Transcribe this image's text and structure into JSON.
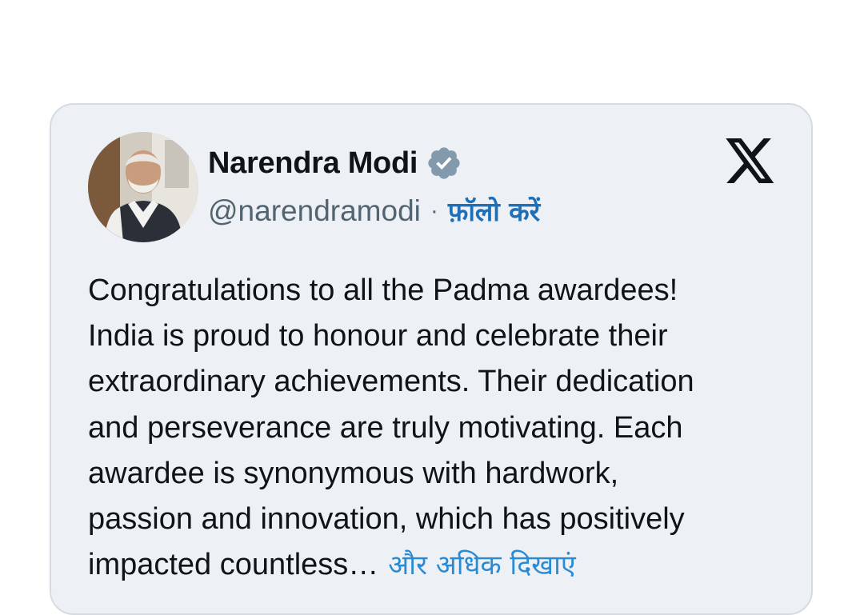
{
  "tweet": {
    "display_name": "Narendra Modi",
    "verified_icon": "verified-badge-icon",
    "handle": "@narendramodi",
    "separator": "·",
    "follow_label": "फ़ॉलो करें",
    "platform_icon": "x-logo-icon",
    "text_lines": [
      "Congratulations to all the Padma awardees!",
      "India is proud to honour and celebrate their",
      "extraordinary achievements. Their dedication",
      "and perseverance are truly motivating. Each",
      "awardee is synonymous with hardwork,",
      "passion and innovation, which has positively",
      "impacted countless…"
    ],
    "show_more_label": "और अधिक दिखाएं"
  },
  "colors": {
    "card_background": "#edf1f5",
    "text": "#0f1419",
    "secondary_text": "#536471",
    "follow_link": "#1d6fb8",
    "show_more_link": "#2a8ad3",
    "verified_badge": "#829aab"
  }
}
